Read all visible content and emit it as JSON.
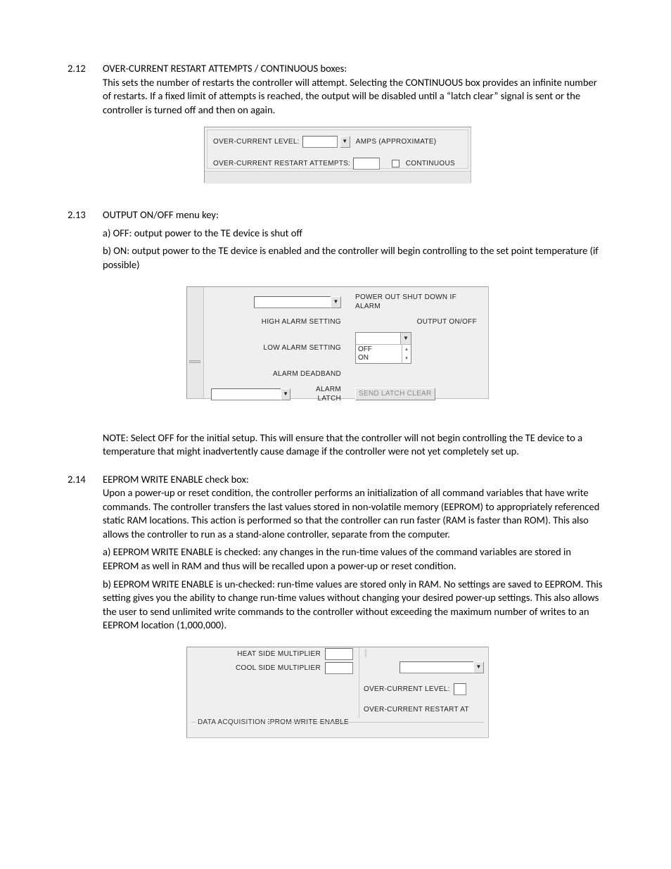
{
  "s212": {
    "num": "2.12",
    "title": "OVER-CURRENT RESTART ATTEMPTS / CONTINUOUS boxes:",
    "desc": "This sets the number of restarts the controller will attempt.  Selecting the CONTINUOUS box provides an infinite number of restarts.  If a fixed limit of attempts is reached, the output will be disabled until a “latch clear” signal is sent or the controller is turned off and then on again."
  },
  "panel1": {
    "over_current_level": "OVER-CURRENT LEVEL:",
    "amps_approx": "AMPS (APPROXIMATE)",
    "restart_attempts": "OVER-CURRENT RESTART ATTEMPTS:",
    "continuous": "CONTINUOUS"
  },
  "s213": {
    "num": "2.13",
    "title": "OUTPUT ON/OFF menu key:",
    "a": "a) OFF: output power to the TE device is shut off",
    "b": "b) ON: output power to the TE device is enabled and the controller will begin controlling to the set point temperature (if possible)"
  },
  "panel2": {
    "power_out": "POWER OUT SHUT DOWN IF ALARM",
    "high_alarm": "HIGH ALARM SETTING",
    "low_alarm": "LOW ALARM SETTING",
    "alarm_deadband": "ALARM DEADBAND",
    "alarm_latch": "ALARM LATCH",
    "output_onoff": "OUTPUT ON/OFF",
    "opt_off": "OFF",
    "opt_on": "ON",
    "send_latch_clear": "SEND LATCH CLEAR"
  },
  "note213": "NOTE: Select OFF for the initial setup.  This will ensure that the controller will not begin controlling the TE device to a temperature that might inadvertently cause damage if the controller were not yet completely set up.",
  "s214": {
    "num": "2.14",
    "title": "EEPROM WRITE ENABLE check box:",
    "desc": "Upon a power-up or reset condition, the controller performs an initialization of all command variables that have write commands.  The controller transfers the last values stored in non-volatile memory (EEPROM) to appropriately referenced static RAM locations.  This action is performed so that the controller can run faster (RAM is faster than ROM). This also allows the controller to run as a stand-alone controller, separate from the computer.",
    "a": "a) EEPROM WRITE ENABLE is checked: any changes in the run-time values of the command variables are stored in EEPROM as well in RAM and thus will be recalled upon a power-up or reset condition.",
    "b": "b) EEPROM WRITE ENABLE is un-checked: run-time values are stored only in RAM. No settings are saved to EEPROM.  This setting gives you the ability to change run-time values without changing your desired power-up settings.  This also allows the user to send unlimited write commands to the controller without exceeding the maximum number of writes to an EEPROM location (1,000,000)."
  },
  "panel3": {
    "heat_side": "HEAT SIDE MULTIPLIER",
    "cool_side": "COOL SIDE MULTIPLIER",
    "eeprom": "EEPROM WRITE ENABLE",
    "over_current_level": "OVER-CURRENT LEVEL:",
    "over_current_restart": "OVER-CURRENT RESTART AT",
    "daq": "DATA ACQUISITION"
  }
}
